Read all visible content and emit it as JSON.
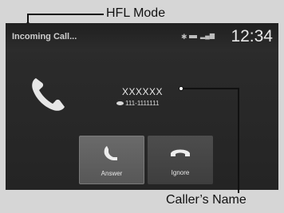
{
  "status_bar": {
    "left_text": "Incoming Call...",
    "clock": "12:34"
  },
  "caller": {
    "name": "XXXXXX",
    "number": "111-1111111"
  },
  "buttons": {
    "answer_label": "Answer",
    "ignore_label": "Ignore"
  },
  "callouts": {
    "hfl_mode": "HFL Mode",
    "callers_name": "Caller’s Name"
  },
  "icons": {
    "big_phone": "phone-handset-icon",
    "answer": "answer-call-icon",
    "ignore": "ignore-call-icon",
    "bluetooth": "bluetooth-icon",
    "battery": "battery-icon",
    "signal": "signal-icon"
  },
  "colors": {
    "screen_bg": "#2b2b2b",
    "answer_bg": "#636363",
    "ignore_bg": "#464646",
    "text": "#e8e8e8"
  }
}
